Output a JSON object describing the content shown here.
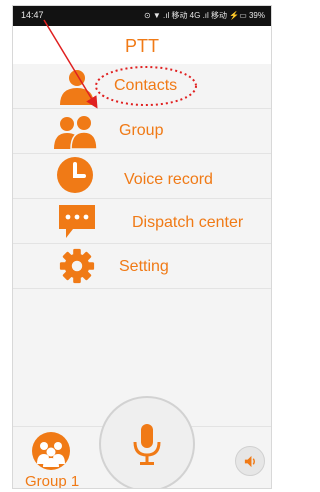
{
  "status_bar": {
    "time": "14:47",
    "right_text": "⊙ ▼ .ıl 移动 4G .ıl 移动 ⚡▭ 39%"
  },
  "header": {
    "title": "PTT"
  },
  "menu": {
    "items": [
      {
        "label": "Contacts",
        "icon": "contacts-icon"
      },
      {
        "label": "Group",
        "icon": "group-icon"
      },
      {
        "label": "Voice record",
        "icon": "clock-icon"
      },
      {
        "label": "Dispatch center",
        "icon": "chat-bubble-icon"
      },
      {
        "label": "Setting",
        "icon": "gear-icon"
      }
    ]
  },
  "bottom_bar": {
    "group_label": "Group 1",
    "ptt_icon": "microphone-icon",
    "speaker_icon": "speaker-icon"
  },
  "colors": {
    "accent": "#f07a16",
    "annotation": "#e02020",
    "background": "#f4f4f4"
  }
}
